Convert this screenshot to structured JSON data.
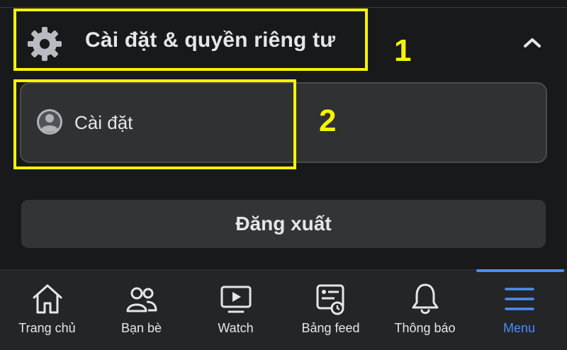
{
  "section": {
    "title": "Cài đặt & quyền riêng tư"
  },
  "settings": {
    "label": "Cài đặt"
  },
  "logout": {
    "label": "Đăng xuất"
  },
  "annotations": [
    {
      "number": "1"
    },
    {
      "number": "2"
    }
  ],
  "nav": {
    "items": [
      {
        "label": "Trang chủ",
        "icon": "home-icon"
      },
      {
        "label": "Bạn bè",
        "icon": "friends-icon"
      },
      {
        "label": "Watch",
        "icon": "watch-icon"
      },
      {
        "label": "Bảng feed",
        "icon": "feed-icon"
      },
      {
        "label": "Thông báo",
        "icon": "bell-icon"
      },
      {
        "label": "Menu",
        "icon": "menu-icon",
        "active": true
      }
    ]
  },
  "colors": {
    "background": "#18191a",
    "card": "#303133",
    "accent": "#4b8ef7",
    "annotation": "#f5f500"
  }
}
